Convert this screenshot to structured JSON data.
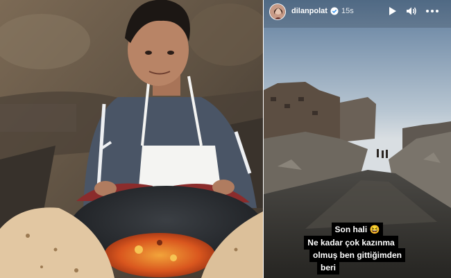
{
  "story": {
    "username": "dilanpolat",
    "time_ago": "15s",
    "caption_line1": "Son hali 😆",
    "caption_line2": "Ne kadar çok kazınma",
    "caption_line3": "olmuş ben gittiğimden",
    "caption_line4": "beri"
  },
  "icons": {
    "verified": "verified-badge-icon",
    "play": "play-icon",
    "mute": "volume-icon",
    "more": "more-options-icon"
  }
}
